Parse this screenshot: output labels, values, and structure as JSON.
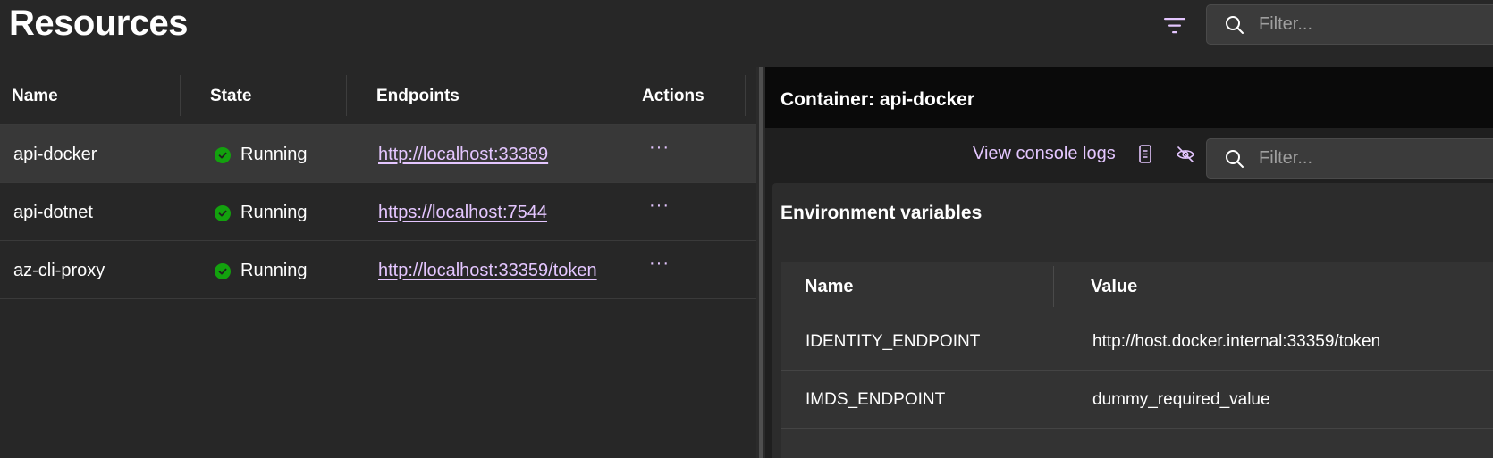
{
  "page": {
    "title": "Resources"
  },
  "top_search": {
    "placeholder": "Filter..."
  },
  "grid": {
    "columns": [
      "Name",
      "State",
      "Endpoints",
      "Actions"
    ],
    "rows": [
      {
        "name": "api-docker",
        "state": "Running",
        "endpoint": "http://localhost:33389",
        "actions": "···",
        "selected": true
      },
      {
        "name": "api-dotnet",
        "state": "Running",
        "endpoint": "https://localhost:7544",
        "actions": "···",
        "selected": false
      },
      {
        "name": "az-cli-proxy",
        "state": "Running",
        "endpoint": "http://localhost:33359/token",
        "actions": "···",
        "selected": false
      }
    ]
  },
  "detail": {
    "title": "Container: api-docker",
    "console_link": "View console logs",
    "search": {
      "placeholder": "Filter..."
    },
    "env": {
      "title": "Environment variables",
      "columns": [
        "Name",
        "Value"
      ],
      "rows": [
        {
          "name": "IDENTITY_ENDPOINT",
          "value": "http://host.docker.internal:33359/token"
        },
        {
          "name": "IMDS_ENDPOINT",
          "value": "dummy_required_value"
        }
      ]
    }
  },
  "colors": {
    "accent": "#e4c6ff",
    "running": "#13a10e",
    "background": "#272727",
    "panel_header": "#0a0a0a"
  },
  "icons": [
    "filter-icon",
    "search-icon",
    "check-circle-icon",
    "more-icon",
    "document-icon",
    "eye-off-icon"
  ]
}
